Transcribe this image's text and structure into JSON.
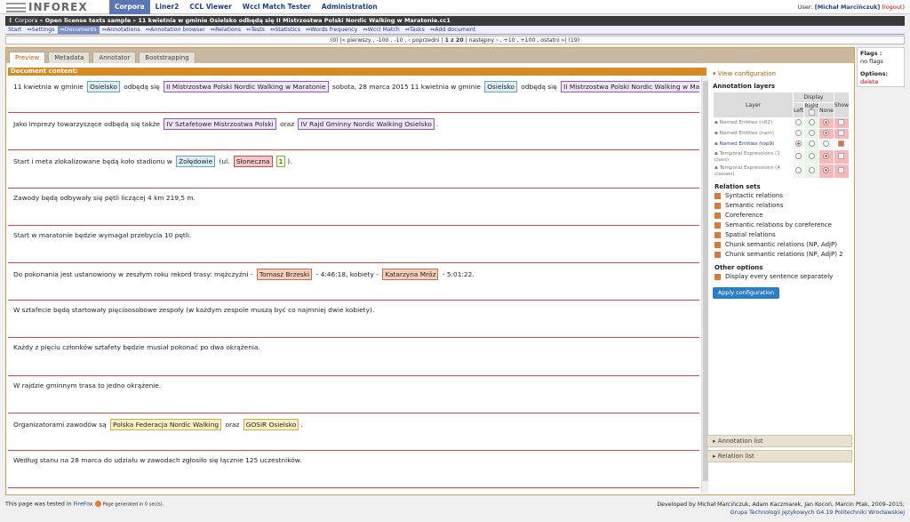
{
  "logo": "INFOREX",
  "mainmenu": [
    "Corpora",
    "Liner2",
    "CCL Viewer",
    "Wccl Match Tester",
    "Administration"
  ],
  "user": {
    "label": "User:",
    "name": "[Michał Marcińczuk]",
    "logout": "(logout)"
  },
  "crumb": {
    "prefix": "↕ Corpora »",
    "corpus": "Open license texts sample",
    "sep": " » ",
    "doc": "11 kwietnia w gminie Osielsko odbędą się II Mistrzostwa Polski Nordic Walking w Maratonie.cc1"
  },
  "submenu": [
    "Start",
    "⇔Settings",
    "⇔Documents",
    "⇔Annotations",
    "⇔Annotation browser",
    "⇔Relations",
    "⇔Tests",
    "⇔Statistics",
    "⇔Words frequency",
    "⇔Wccl Match",
    "⇔Tasks",
    "⇔Add document"
  ],
  "pager": {
    "left": "(0) |« pierwszy , -100 , -10 , ‹ poprzedni |",
    "cur": "1 z 20",
    "right": "| następny › , +10 , +100 , ostatni »| (19)"
  },
  "tabs": [
    "Preview",
    "Metadata",
    "Annotator",
    "Bootstrapping"
  ],
  "doc_header": "Document content:",
  "sentences": [
    [
      {
        "t": "11 kwietnia w gminie "
      },
      {
        "a": "place",
        "t": "Osielsko"
      },
      {
        "t": " odbędą się "
      },
      {
        "a": "event",
        "t": "II Mistrzostwa Polski Nordic Walking w Maratonie"
      },
      {
        "t": " sobota, 28 marca 2015 11 kwietnia w gminie "
      },
      {
        "a": "place",
        "t": "Osielsko"
      },
      {
        "t": " odbędą się "
      },
      {
        "a": "event",
        "t": "II Mistrzostwa Polski Nordic Walking w Maratonie"
      },
      {
        "t": "."
      }
    ],
    [
      {
        "t": "Jako imprezy towarzyszące odbędą się także "
      },
      {
        "a": "event",
        "t": "IV Sztafetowe Mistrzostwa Polski"
      },
      {
        "t": " oraz "
      },
      {
        "a": "event",
        "t": "IV Rajd Gminny Nordic Walking Osielsko"
      },
      {
        "t": "."
      }
    ],
    [
      {
        "t": "Start i meta zlokalizowane będą koło stadionu w "
      },
      {
        "a": "place",
        "t": "Żołędowie"
      },
      {
        "t": " (ul. "
      },
      {
        "a": "road",
        "t": "Słoneczna"
      },
      {
        "a": "num",
        "t": "1"
      },
      {
        "t": ")."
      }
    ],
    [
      {
        "t": "Zawody będą odbywały się pętli liczącej 4 km 219,5 m."
      }
    ],
    [
      {
        "t": "Start w maratonie będzie wymagał przebycia 10 pętli."
      }
    ],
    [
      {
        "t": "Do pokonania jest ustanowiony w zeszłym roku rekord trasy: mężczyźni - "
      },
      {
        "a": "person",
        "t": "Tomasz Brzeski"
      },
      {
        "t": " - 4:46:18, kobiety - "
      },
      {
        "a": "person",
        "t": "Katarzyna Mróz"
      },
      {
        "t": " - 5:01:22."
      }
    ],
    [
      {
        "t": "W sztafecie będą startowały pięcioosobowe zespoły (w każdym zespole muszą być co najmniej dwie kobiety)."
      }
    ],
    [
      {
        "t": "Każdy z pięciu członków sztafety będzie musiał pokonać po dwa okrążenia."
      }
    ],
    [
      {
        "t": "W rajdzie gminnym trasa to jedno okrążenie."
      }
    ],
    [
      {
        "t": "Organizatorami zawodów są "
      },
      {
        "a": "org",
        "t": "Polska Federacja Nordic Walking"
      },
      {
        "t": " oraz "
      },
      {
        "a": "org",
        "t": "GOSiR Osielsko"
      },
      {
        "t": "."
      }
    ],
    [
      {
        "t": "Według stanu na 28 marca do udziału w zawodach zgłosiło się łącznie 125 uczestników."
      }
    ]
  ],
  "config": {
    "view_label": "View configuration",
    "layers_title": "Annotation layers",
    "cols": {
      "layer": "Layer",
      "display": "Display",
      "left": "Left",
      "right": "Right",
      "none": "None",
      "show": "Show"
    },
    "layers": [
      {
        "name": "Named Entities (n82)",
        "sel": "none",
        "show": false
      },
      {
        "name": "Named Entities (nam)",
        "sel": "none",
        "show": false
      },
      {
        "name": "Named Entities (top9)",
        "sel": "left",
        "show": true
      },
      {
        "name": "Temporal Expressions (1 class)",
        "sel": "none",
        "show": false
      },
      {
        "name": "Temporal Expressions (4 classes)",
        "sel": "none",
        "show": false
      }
    ],
    "relation_title": "Relation sets",
    "relations": [
      "Syntactic relations",
      "Semantic relations",
      "Coreference",
      "Semantic relations by coreference",
      "Spatial relations",
      "Chunk semantic relations (NP, AdjP)",
      "Chunk semantic relations (NP, AdjP) 2"
    ],
    "other_title": "Other options",
    "other": [
      "Display every sentence separately"
    ],
    "apply": "Apply configuration"
  },
  "annotation_list": "Annotation list",
  "relation_list": "Relation list",
  "flags": {
    "title": "Flags :",
    "value": "no flags",
    "options_title": "Options:",
    "delete": "delete"
  },
  "footer": {
    "tested": "This page was tested in",
    "firefox": "FireFox",
    "generated": "Page generated in 0 sec(s).",
    "dev1": "Developed by Michał Marcińczuk, Adam Kaczmarek, Jan Kocoń, Marcin Ptak, 2009–2015;",
    "dev2": "Grupa Technologii Językowych G4.19 Politechniki Wrocławskiej"
  }
}
